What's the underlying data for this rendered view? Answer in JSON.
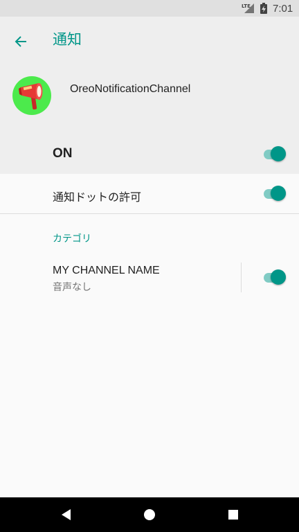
{
  "status_bar": {
    "network": "LTE",
    "time": "7:01"
  },
  "header": {
    "title": "通知",
    "app_name": "OreoNotificationChannel",
    "app_icon_color": "#4cea4c",
    "master_switch_label": "ON",
    "master_switch_on": true
  },
  "settings": {
    "notification_dot_label": "通知ドットの許可",
    "notification_dot_on": true
  },
  "categories": {
    "header": "カテゴリ",
    "channels": [
      {
        "name": "MY CHANNEL NAME",
        "summary": "音声なし",
        "enabled": true
      }
    ]
  },
  "colors": {
    "accent": "#009688",
    "track": "#80cbc4",
    "header_bg": "#eeeeee",
    "body_bg": "#fafafa"
  },
  "icons": {
    "back": "arrow-left-icon",
    "app": "megaphone-icon",
    "nav_back": "triangle-back-icon",
    "nav_home": "circle-home-icon",
    "nav_recents": "square-recents-icon"
  }
}
